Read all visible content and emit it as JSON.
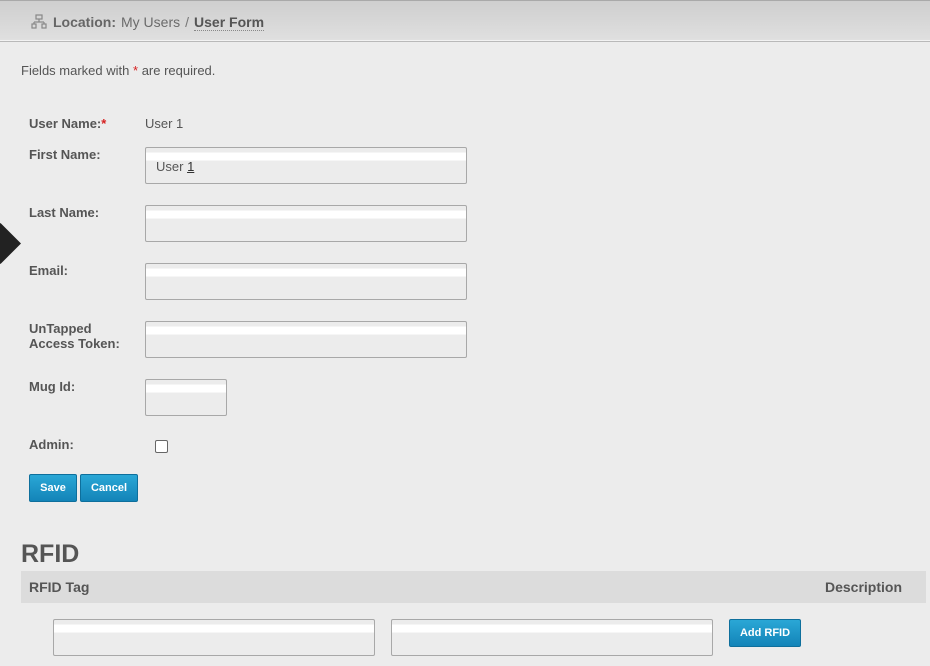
{
  "breadcrumb": {
    "icon": "sitemap-icon",
    "location_label": "Location:",
    "parent": "My Users",
    "separator": "/",
    "current": "User Form"
  },
  "form": {
    "required_prefix": "Fields marked with",
    "required_star": "*",
    "required_suffix": "are required.",
    "username": {
      "label": "User Name:",
      "star": "*",
      "value": "User 1"
    },
    "first_name": {
      "label": "First Name:",
      "value_prefix": "User ",
      "value_last": "1"
    },
    "last_name": {
      "label": "Last Name:",
      "value": ""
    },
    "email": {
      "label": "Email:",
      "value": ""
    },
    "untapped_token": {
      "label_line1": "UnTapped",
      "label_line2": "Access Token:",
      "value": ""
    },
    "mug_id": {
      "label": "Mug Id:",
      "value": ""
    },
    "admin": {
      "label": "Admin:",
      "checked": false
    },
    "save_label": "Save",
    "cancel_label": "Cancel"
  },
  "rfid": {
    "heading": "RFID",
    "columns": [
      "RFID Tag",
      "Description"
    ],
    "tag_value": "",
    "description_value": "",
    "add_label": "Add RFID"
  },
  "colors": {
    "accent_button": "#1a95c9",
    "required_star": "#d62020",
    "background": "#ececec"
  }
}
